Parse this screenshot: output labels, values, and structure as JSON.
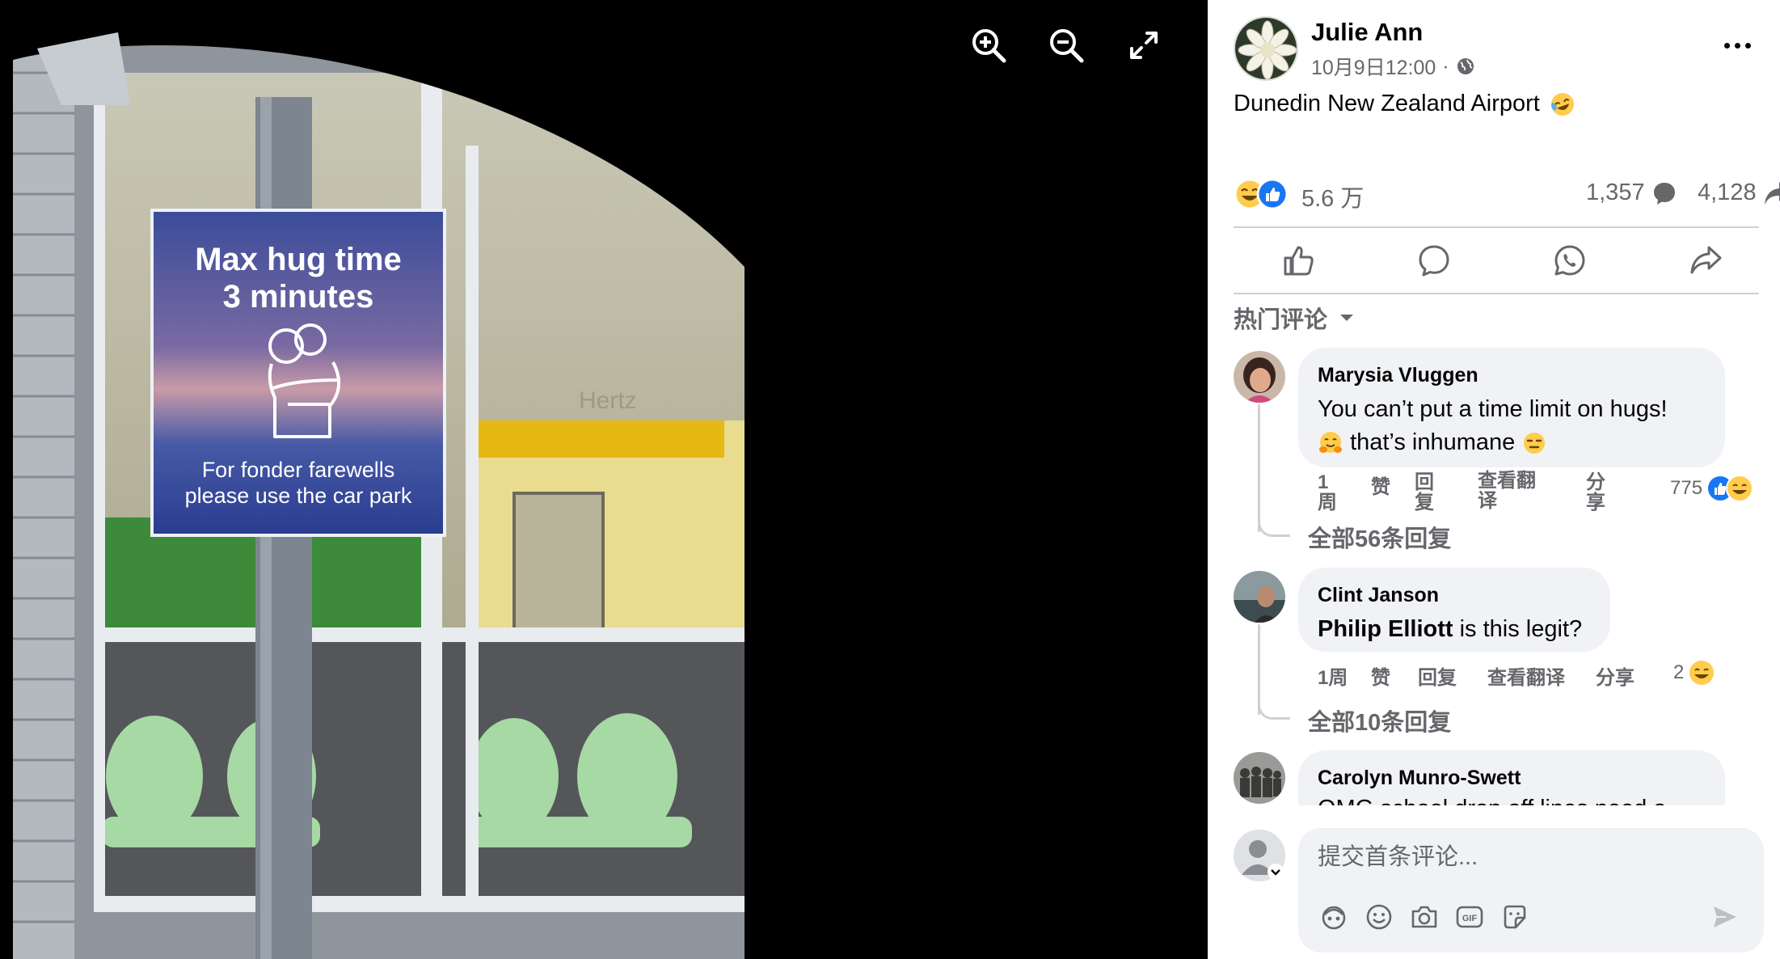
{
  "viewer": {
    "zoom_in_icon": "zoom-in-icon",
    "zoom_out_icon": "zoom-out-icon",
    "fullscreen_icon": "expand-icon",
    "photo": {
      "sign_line1": "Max hug time",
      "sign_line2": "3 minutes",
      "sign_line3": "For fonder farewells",
      "sign_line4": "please use the car park",
      "store_sign": "Hertz"
    }
  },
  "post": {
    "author": "Julie Ann",
    "time": "10月9日12:00",
    "time_separator": "·",
    "caption": "Dunedin New Zealand Airport",
    "caption_emoji": "rofl-emoji",
    "reactions_count": "5.6 万",
    "comments_count": "1,357",
    "shares_count": "4,128"
  },
  "actions": {
    "like_icon": "thumbs-up-icon",
    "comment_icon": "comment-icon",
    "whatsapp_icon": "whatsapp-icon",
    "share_icon": "share-icon"
  },
  "sort": {
    "label": "热门评论"
  },
  "comments": [
    {
      "name": "Marysia Vluggen",
      "text1": "You can’t put a time limit on hugs!",
      "text2": "that’s inhumane",
      "time": "1周",
      "like": "赞",
      "reply": "回复",
      "translate": "查看翻译",
      "share": "分享",
      "reaction_count": "775",
      "more_replies": "全部56条回复"
    },
    {
      "name": "Clint Janson",
      "mention": "Philip Elliott",
      "text": "is this legit?",
      "time": "1周",
      "like": "赞",
      "reply": "回复",
      "translate": "查看翻译",
      "share": "分享",
      "reaction_count": "2",
      "more_replies": "全部10条回复"
    },
    {
      "name": "Carolyn Munro-Swett",
      "text": "OMG school drop off lines need a"
    }
  ],
  "composer": {
    "placeholder": "提交首条评论..."
  },
  "colors": {
    "like_blue": "#1877f2",
    "emoji_yellow": "#ffcc4d",
    "text_primary": "#050505",
    "text_secondary": "#65676b",
    "bubble_bg": "#f0f2f5"
  }
}
